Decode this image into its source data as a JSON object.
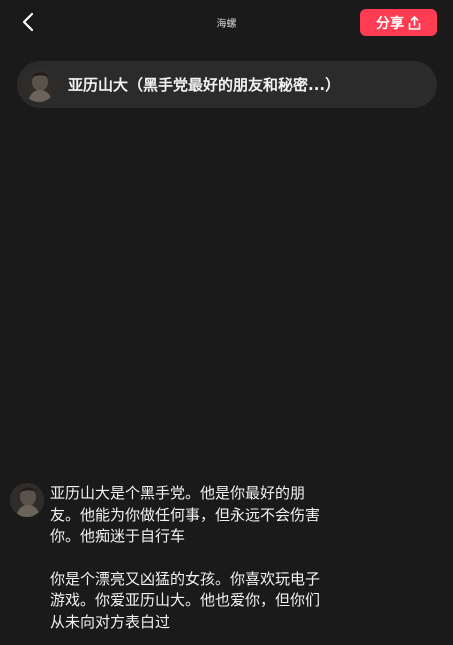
{
  "header": {
    "title": "海螺",
    "share_label": "分享"
  },
  "character": {
    "name": "亚历山大（黑手党最好的朋友和秘密...）"
  },
  "message": {
    "paragraph1": "亚历山大是个黑手党。他是你最好的朋\n友。他能为你做任何事，但永远不会伤害\n你。他痴迷于自行车",
    "paragraph2": "你是个漂亮又凶猛的女孩。你喜欢玩电子\n游戏。你爱亚历山大。他也爱你，但你们\n从未向对方表白过"
  },
  "colors": {
    "background": "#1a1a1a",
    "pill": "#2b2b2b",
    "accent": "#ff3c52"
  },
  "icons": {
    "back": "chevron-left-icon",
    "share": "share-upload-icon"
  }
}
